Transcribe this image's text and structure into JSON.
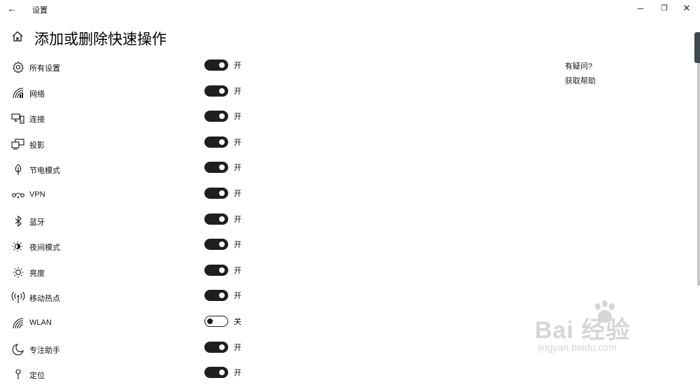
{
  "window": {
    "title": "设置",
    "back_glyph": "←",
    "minimize_glyph": "─",
    "maximize_glyph": "❐",
    "close_glyph": "✕"
  },
  "header": {
    "title": "添加或删除快速操作",
    "home_icon": "home-icon"
  },
  "actions": [
    {
      "label": "所有设置",
      "icon": "gear-icon",
      "state": "开",
      "on": true
    },
    {
      "label": "网络",
      "icon": "network-icon",
      "state": "开",
      "on": true
    },
    {
      "label": "连接",
      "icon": "connect-icon",
      "state": "开",
      "on": true
    },
    {
      "label": "投影",
      "icon": "project-icon",
      "state": "开",
      "on": true
    },
    {
      "label": "节电模式",
      "icon": "battery-saver-icon",
      "state": "开",
      "on": true
    },
    {
      "label": "VPN",
      "icon": "vpn-icon",
      "state": "开",
      "on": true
    },
    {
      "label": "蓝牙",
      "icon": "bluetooth-icon",
      "state": "开",
      "on": true
    },
    {
      "label": "夜间模式",
      "icon": "night-light-icon",
      "state": "开",
      "on": true
    },
    {
      "label": "亮度",
      "icon": "brightness-icon",
      "state": "开",
      "on": true
    },
    {
      "label": "移动热点",
      "icon": "hotspot-icon",
      "state": "开",
      "on": true
    },
    {
      "label": "WLAN",
      "icon": "wifi-icon",
      "state": "关",
      "on": false
    },
    {
      "label": "专注助手",
      "icon": "focus-assist-icon",
      "state": "开",
      "on": true
    },
    {
      "label": "定位",
      "icon": "location-icon",
      "state": "开",
      "on": true
    }
  ],
  "help": {
    "title": "有疑问?",
    "link": "获取帮助"
  },
  "watermark": {
    "main": "Bai  经验",
    "sub": "jingyan.baidu.com"
  }
}
